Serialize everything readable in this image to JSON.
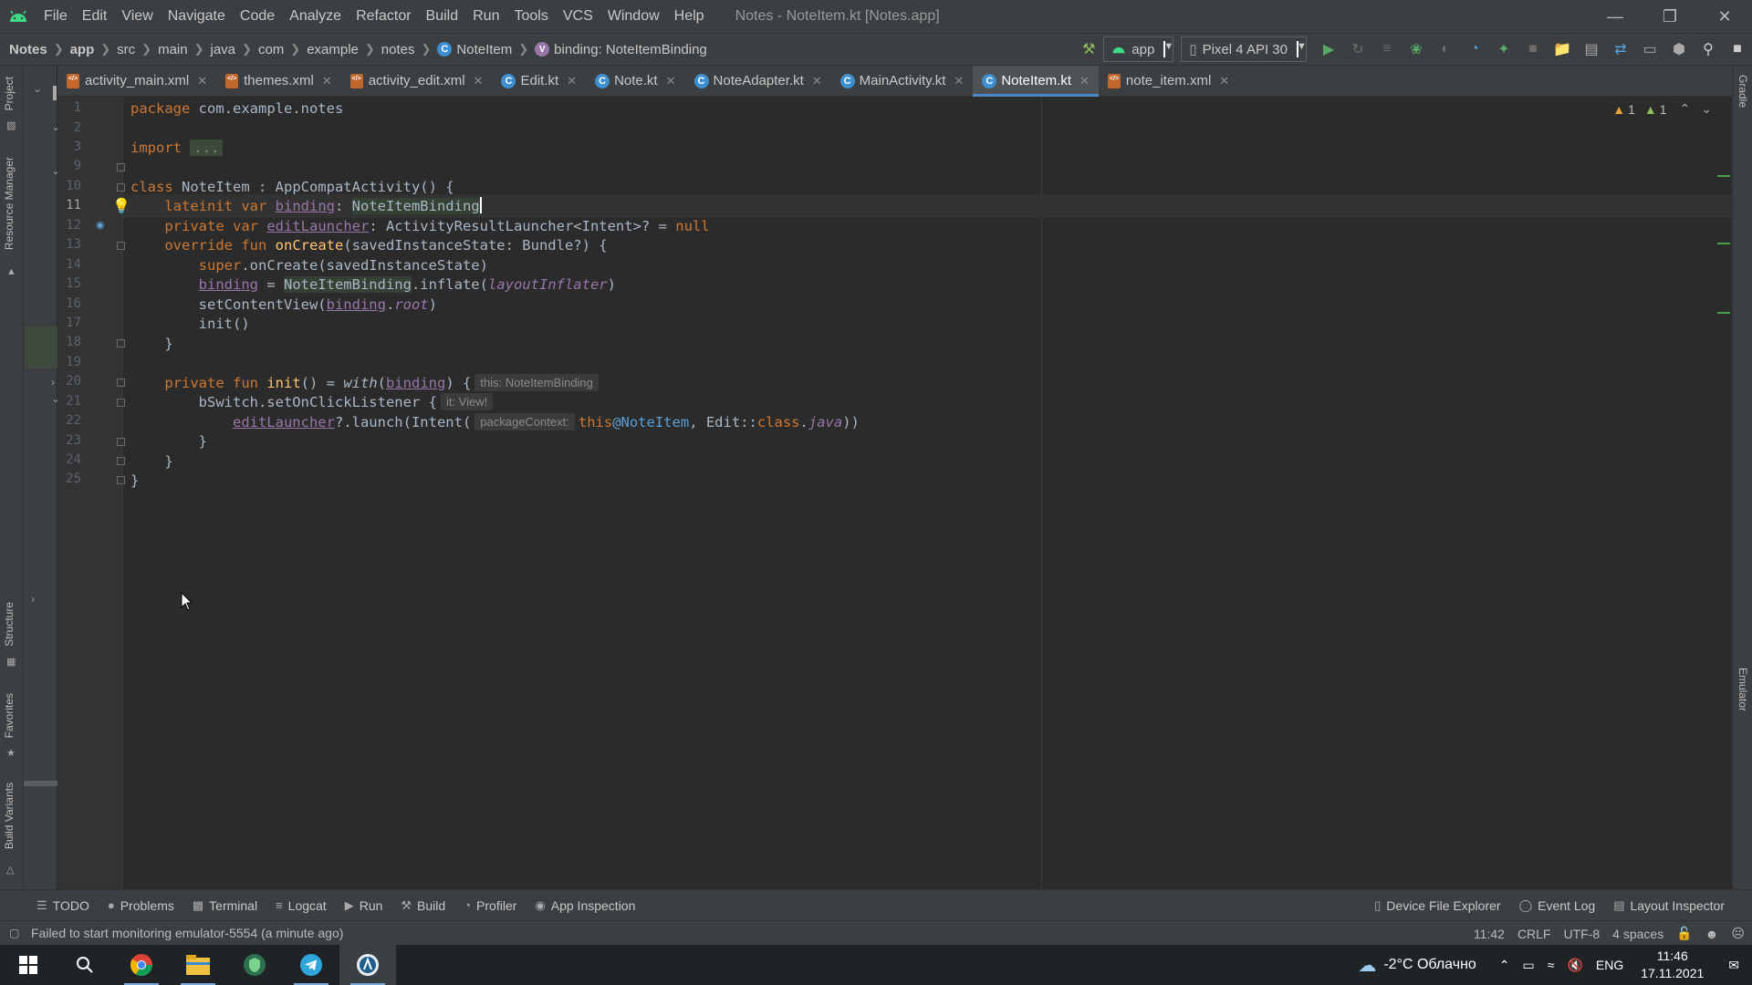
{
  "window": {
    "title": "Notes - NoteItem.kt [Notes.app]",
    "menu": [
      "File",
      "Edit",
      "View",
      "Navigate",
      "Code",
      "Analyze",
      "Refactor",
      "Build",
      "Run",
      "Tools",
      "VCS",
      "Window",
      "Help"
    ]
  },
  "breadcrumb": {
    "items": [
      "Notes",
      "app",
      "src",
      "main",
      "java",
      "com",
      "example",
      "notes",
      "NoteItem",
      "binding: NoteItemBinding"
    ]
  },
  "run_config": {
    "module": "app",
    "device": "Pixel 4 API 30"
  },
  "left_tools": {
    "project": "Project",
    "resource_manager": "Resource Manager",
    "structure": "Structure",
    "favorites": "Favorites",
    "build_variants": "Build Variants"
  },
  "right_tools": {
    "gradle": "Gradle",
    "emulator": "Emulator"
  },
  "tabs": [
    {
      "label": "activity_main.xml",
      "icon": "xml-icon"
    },
    {
      "label": "themes.xml",
      "icon": "xml-icon"
    },
    {
      "label": "activity_edit.xml",
      "icon": "xml-icon"
    },
    {
      "label": "Edit.kt",
      "icon": "kotlin-class-icon"
    },
    {
      "label": "Note.kt",
      "icon": "kotlin-class-icon"
    },
    {
      "label": "NoteAdapter.kt",
      "icon": "kotlin-class-icon"
    },
    {
      "label": "MainActivity.kt",
      "icon": "kotlin-class-icon"
    },
    {
      "label": "NoteItem.kt",
      "icon": "kotlin-class-icon",
      "active": true
    },
    {
      "label": "note_item.xml",
      "icon": "xml-icon"
    }
  ],
  "editor": {
    "line_numbers": [
      "1",
      "2",
      "3",
      "9",
      "10",
      "11",
      "12",
      "13",
      "14",
      "15",
      "16",
      "17",
      "18",
      "19",
      "20",
      "21",
      "22",
      "23",
      "24",
      "25"
    ],
    "current_line": "11",
    "inspections": {
      "warnings": "1",
      "weak_warnings": "1"
    },
    "hints": {
      "this_hint": "this: NoteItemBinding",
      "it_hint": "it: View!",
      "package_context": "packageContext:"
    },
    "code": {
      "l1_kw": "package",
      "l1_rest": " com.example.notes",
      "l3_kw": "import",
      "l3_fold": "...",
      "l10_kw": "class",
      "l10_rest": " NoteItem : AppCompatActivity() {",
      "l11_kw": "lateinit var",
      "l11_prop": "binding",
      "l11_colon": ": ",
      "l11_type": "NoteItemBinding",
      "l12_kw": "private var",
      "l12_prop": "editLauncher",
      "l12_rest": ": ActivityResultLauncher<Intent>? = ",
      "l12_null": "null",
      "l13_kw": "override fun",
      "l13_fn": "onCreate",
      "l13_rest": "(savedInstanceState: Bundle?) {",
      "l14_kw": "super",
      "l14_rest": ".onCreate(savedInstanceState)",
      "l15_prop": "binding",
      "l15_eq": " = ",
      "l15_type": "NoteItemBinding",
      "l15_call": ".inflate(",
      "l15_arg": "layoutInflater",
      "l15_end": ")",
      "l16_call": "setContentView(",
      "l16_prop": "binding",
      "l16_dot": ".",
      "l16_root": "root",
      "l16_end": ")",
      "l17": "init()",
      "l18": "}",
      "l20_kw": "private fun",
      "l20_fn": "init",
      "l20_mid": "() = ",
      "l20_with": "with",
      "l20_paren": "(",
      "l20_prop": "binding",
      "l20_end": ") {",
      "l21": "bSwitch.setOnClickListener {",
      "l22_prop": "editLauncher",
      "l22_mid": "?.launch(Intent(",
      "l22_kw": "this",
      "l22_label": "@NoteItem",
      "l22_rest1": ", Edit::",
      "l22_class": "class",
      "l22_dot": ".",
      "l22_java": "java",
      "l22_end": "))",
      "l23": "}",
      "l24": "}",
      "l25": "}"
    }
  },
  "bottom_tools": {
    "left": [
      "TODO",
      "Problems",
      "Terminal",
      "Logcat",
      "Run",
      "Build",
      "Profiler",
      "App Inspection"
    ],
    "right": [
      "Device File Explorer",
      "Event Log",
      "Layout Inspector"
    ]
  },
  "status": {
    "message": "Failed to start monitoring emulator-5554 (a minute ago)",
    "position": "11:42",
    "line_sep": "CRLF",
    "encoding": "UTF-8",
    "indent": "4 spaces"
  },
  "taskbar": {
    "weather": "-2°C Облачно",
    "lang": "ENG",
    "time": "11:46",
    "date": "17.11.2021"
  },
  "colors": {
    "keyword": "#cc7832",
    "function": "#ffc66d",
    "property": "#9876aa",
    "text": "#a9b7c6",
    "accent": "#4a88c7",
    "android_green": "#3ddc84"
  }
}
